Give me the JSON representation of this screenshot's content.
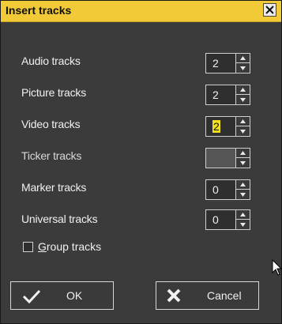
{
  "dialog": {
    "title": "Insert tracks",
    "close_glyph": "×",
    "rows": [
      {
        "label": "Audio tracks",
        "value": "2",
        "disabled": false
      },
      {
        "label": "Picture tracks",
        "value": "2",
        "disabled": false
      },
      {
        "label": "Video tracks",
        "value": "2",
        "disabled": false,
        "selected": true
      },
      {
        "label": "Ticker tracks",
        "value": "",
        "disabled": true
      },
      {
        "label": "Marker tracks",
        "value": "0",
        "disabled": false
      },
      {
        "label": "Universal tracks",
        "value": "0",
        "disabled": false
      }
    ],
    "group_tracks": {
      "label_first": "G",
      "label_rest": "roup tracks",
      "checked": false
    },
    "ok_label": "OK",
    "cancel_label": "Cancel"
  },
  "colors": {
    "title_bar": "#f2c936",
    "selection": "#f2e020",
    "background": "#3b3b3b"
  },
  "icons": {
    "ok": "checkmark-icon",
    "cancel": "x-icon",
    "spin_up": "triangle-up-icon",
    "spin_down": "triangle-down-icon"
  }
}
